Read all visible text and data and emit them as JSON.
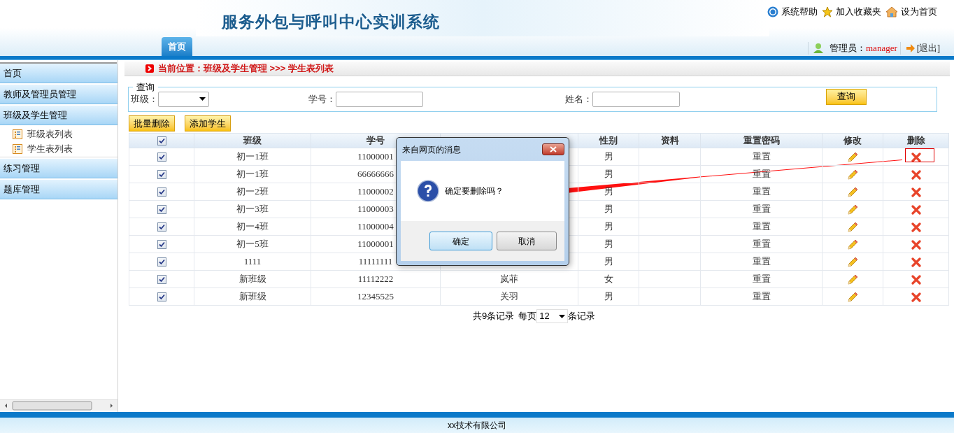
{
  "header": {
    "title": "服务外包与呼叫中心实训系统",
    "links": [
      {
        "kind": "help",
        "label": "系统帮助"
      },
      {
        "kind": "star",
        "label": "加入收藏夹"
      },
      {
        "kind": "home",
        "label": "设为首页"
      }
    ],
    "tabs": [
      {
        "label": "首页",
        "selected": true
      }
    ],
    "user": {
      "label": "管理员：",
      "name": "manager"
    },
    "logout": "[退出]"
  },
  "sidebar": {
    "items": [
      {
        "label": "首页"
      },
      {
        "label": "教师及管理员管理"
      },
      {
        "label": "班级及学生管理",
        "children": [
          {
            "label": "班级表列表"
          },
          {
            "label": "学生表列表"
          }
        ]
      },
      {
        "label": "练习管理"
      },
      {
        "label": "题库管理"
      }
    ]
  },
  "breadcrumb": "当前位置：班级及学生管理 >>> 学生表列表",
  "query": {
    "legend": "查询",
    "fields": [
      {
        "kind": "select",
        "label": "班级："
      },
      {
        "kind": "text",
        "label": "学号："
      },
      {
        "kind": "text",
        "label": "姓名："
      }
    ],
    "button": "查询"
  },
  "actions": [
    "批量删除",
    "添加学生"
  ],
  "table": {
    "all_checked": true,
    "columns": [
      {
        "label": "班级"
      },
      {
        "label": "学号"
      },
      {},
      {
        "label": "性别"
      },
      {
        "label": "资料"
      },
      {
        "label": "重置密码"
      },
      {
        "label": "修改"
      },
      {
        "label": "删除"
      }
    ],
    "rows": [
      {
        "checked": true,
        "class": "初一1班",
        "number": "11000001",
        "gender": "男",
        "reset": "重置"
      },
      {
        "checked": true,
        "class": "初一1班",
        "number": "66666666",
        "gender": "男",
        "reset": "重置"
      },
      {
        "checked": true,
        "class": "初一2班",
        "number": "11000002",
        "gender": "男",
        "reset": "重置"
      },
      {
        "checked": true,
        "class": "初一3班",
        "number": "11000003",
        "gender": "男",
        "reset": "重置"
      },
      {
        "checked": true,
        "class": "初一4班",
        "number": "11000004",
        "gender": "男",
        "reset": "重置"
      },
      {
        "checked": true,
        "class": "初一5班",
        "number": "11000001",
        "gender": "男",
        "reset": "重置"
      },
      {
        "checked": true,
        "class": "1111",
        "number": "11111111",
        "gender": "男",
        "reset": "重置"
      },
      {
        "checked": true,
        "class": "新班级",
        "number": "11112222",
        "name": "岚菲",
        "gender": "女",
        "reset": "重置"
      },
      {
        "checked": true,
        "class": "新班级",
        "number": "12345525",
        "name": "关羽",
        "gender": "男",
        "reset": "重置"
      }
    ]
  },
  "pagination": {
    "summary": "共9条记录",
    "per_page_label": "每页",
    "per_page": "12",
    "suffix": "条记录"
  },
  "dialog": {
    "title": "来自网页的消息",
    "message": "确定要删除吗？",
    "buttons": [
      {
        "label": "确定",
        "selected": true
      },
      {
        "label": "取消",
        "selected": false
      }
    ]
  },
  "footer": "xx技术有限公司"
}
